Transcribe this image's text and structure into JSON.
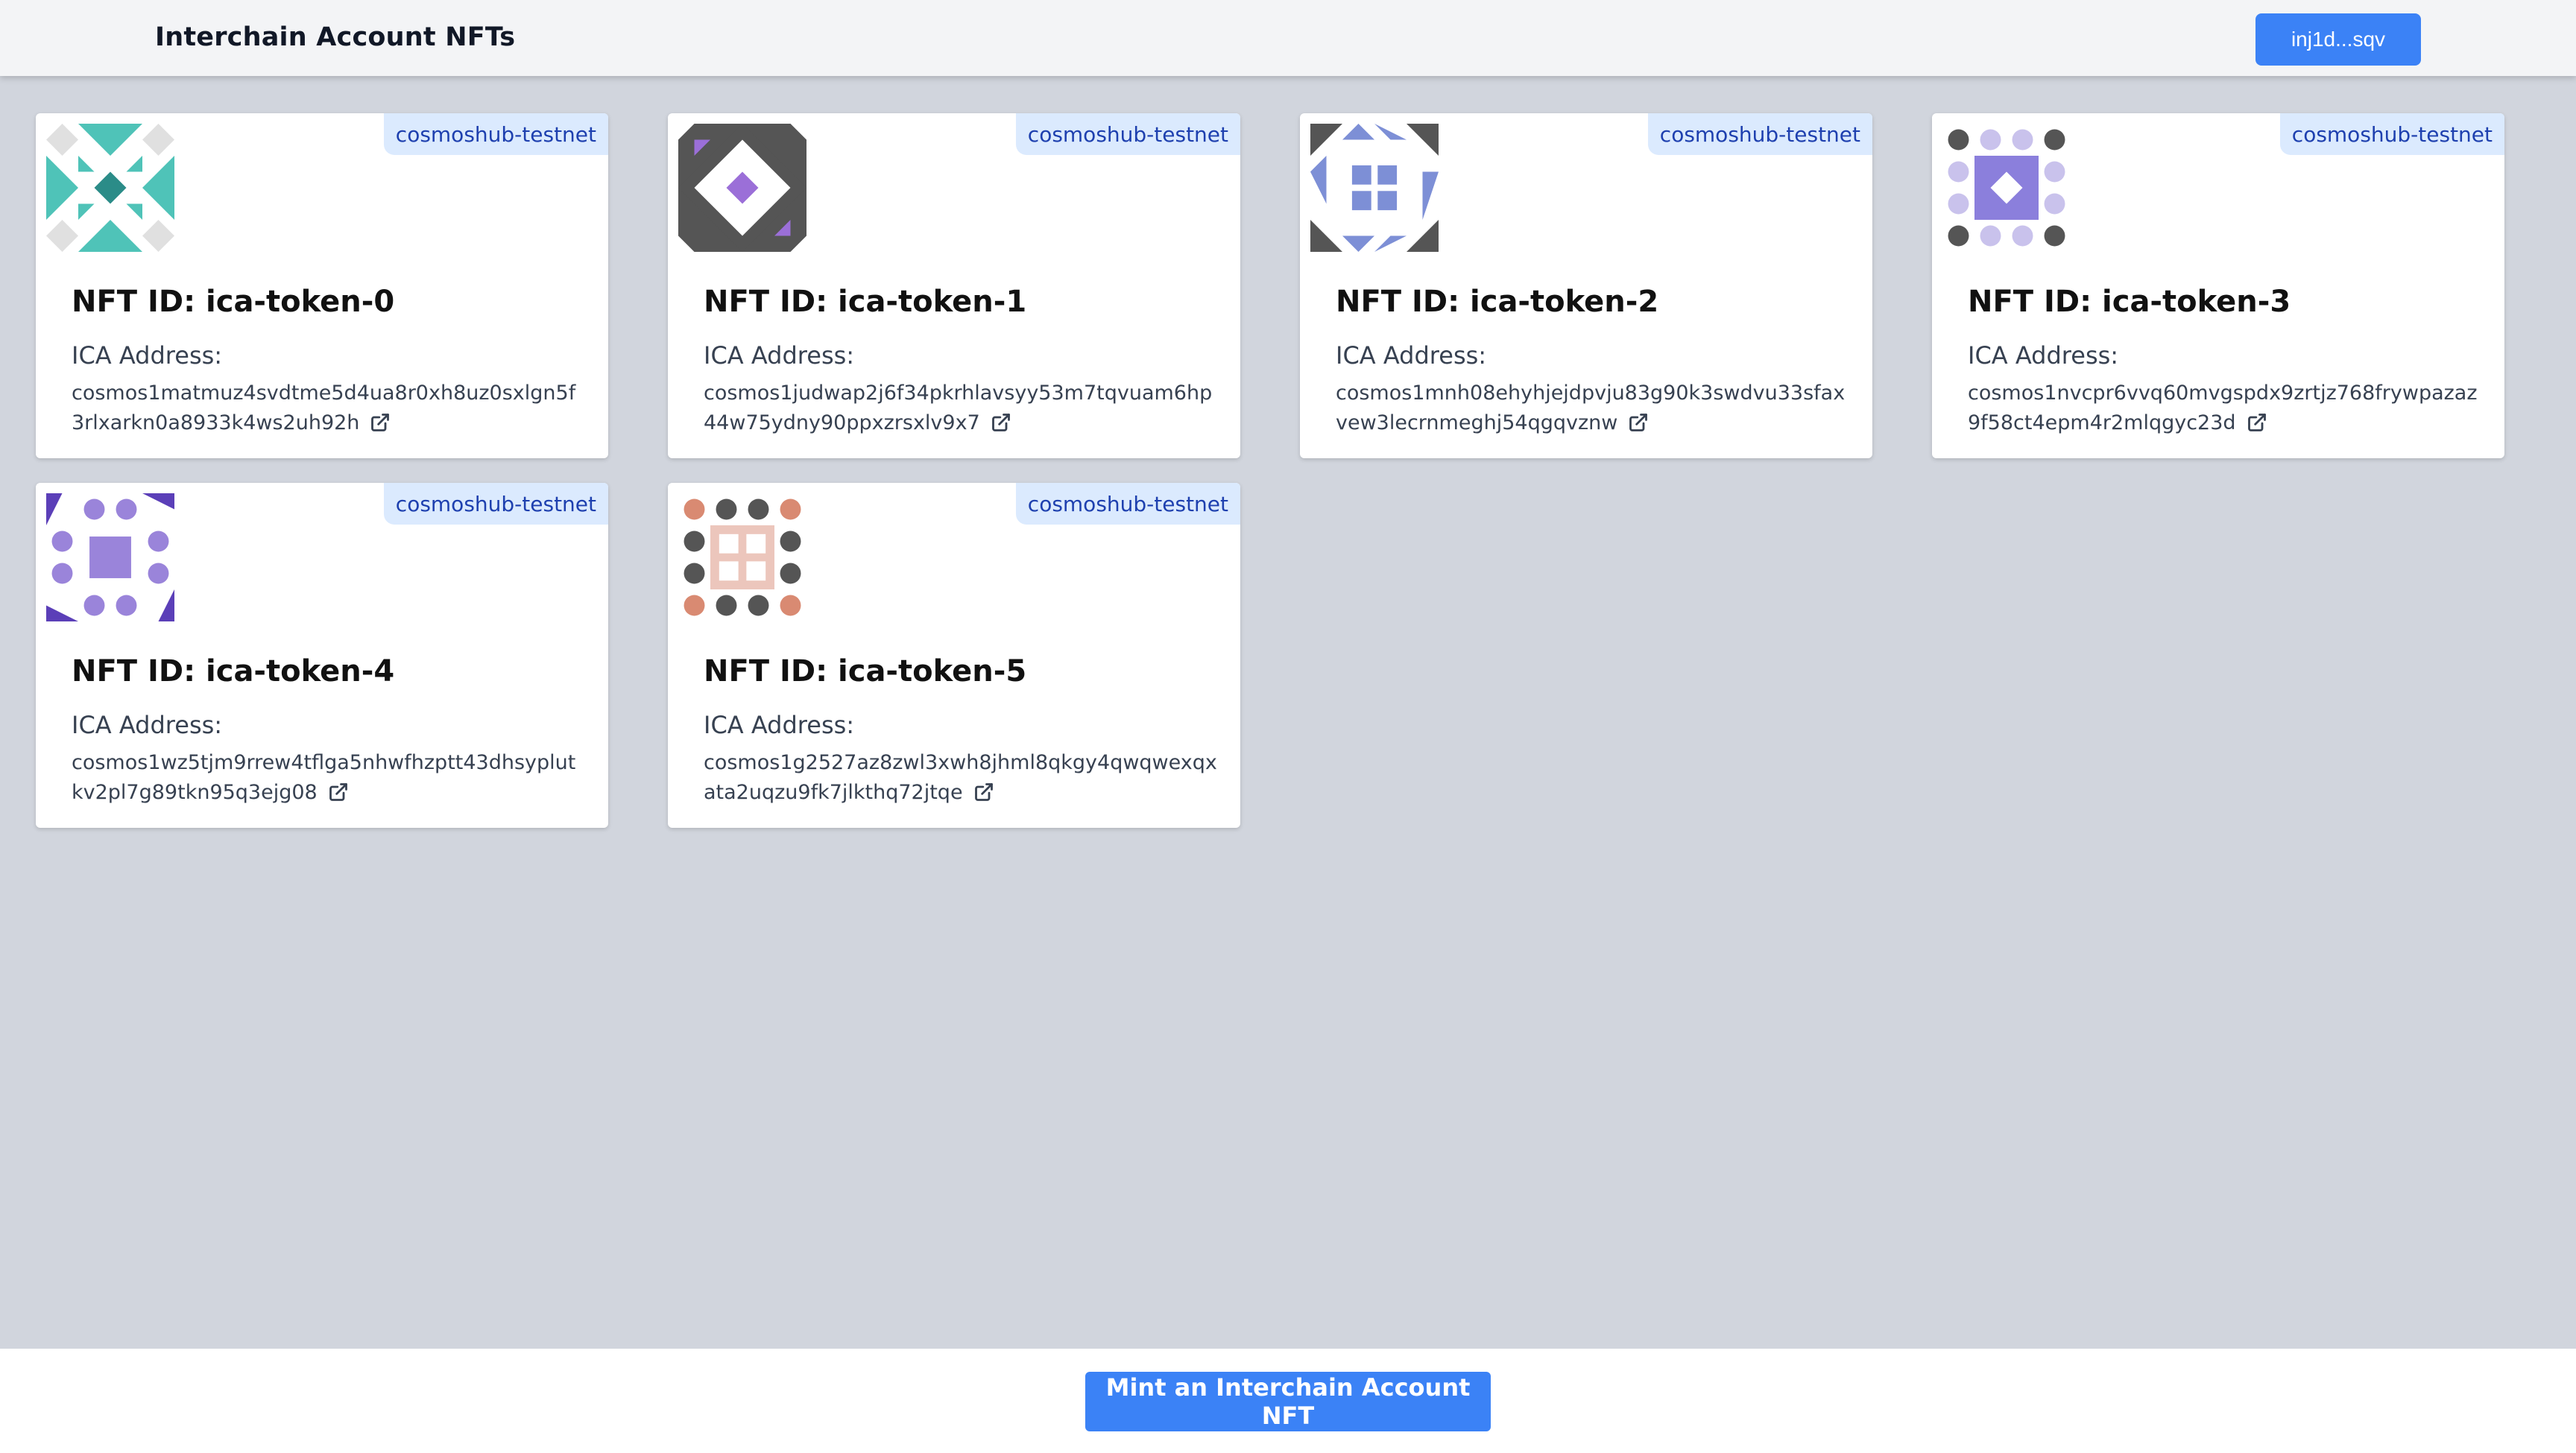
{
  "header": {
    "title": "Interchain Account NFTs",
    "wallet_label": "inj1d...sqv"
  },
  "nft_id_prefix": "NFT ID: ",
  "address_label": "ICA Address:",
  "nfts": [
    {
      "id": "NFT ID: ica-token-0",
      "chain": "cosmoshub-testnet",
      "address": "cosmos1matmuz4svdtme5d4ua8r0xh8uz0sxlgn5f3rlxarkn0a8933k4ws2uh92h",
      "avatar_color": "#4fc3b8"
    },
    {
      "id": "NFT ID: ica-token-1",
      "chain": "cosmoshub-testnet",
      "address": "cosmos1judwap2j6f34pkrhlavsyy53m7tqvuam6hp44w75ydny90ppxzrsxlv9x7",
      "avatar_color": "#9b6fd8"
    },
    {
      "id": "NFT ID: ica-token-2",
      "chain": "cosmoshub-testnet",
      "address": "cosmos1mnh08ehyhjejdpvju83g90k3swdvu33sfaxvew3lecrnmeghj54qgqvznw",
      "avatar_color": "#7d8fd6"
    },
    {
      "id": "NFT ID: ica-token-3",
      "chain": "cosmoshub-testnet",
      "address": "cosmos1nvcpr6vvq60mvgspdx9zrtjz768frywpazaz9f58ct4epm4r2mlqgyc23d",
      "avatar_color": "#8b7fdc"
    },
    {
      "id": "NFT ID: ica-token-4",
      "chain": "cosmoshub-testnet",
      "address": "cosmos1wz5tjm9rrew4tflga5nhwfhzptt43dhsyplutkv2pl7g89tkn95q3ejg08",
      "avatar_color": "#8e78d2"
    },
    {
      "id": "NFT ID: ica-token-5",
      "chain": "cosmoshub-testnet",
      "address": "cosmos1g2527az8zwl3xwh8jhml8qkgy4qwqwexqxata2uqzu9fk7jlkthq72jtqe",
      "avatar_color": "#d98a72"
    }
  ],
  "footer": {
    "mint_label": "Mint an Interchain Account NFT"
  },
  "colors": {
    "accent": "#3b82f6",
    "badge_bg": "#dbeafe",
    "badge_text": "#1e40af",
    "page_bg": "#d1d5dd"
  },
  "icons": {
    "external_link": "external-link-icon"
  }
}
